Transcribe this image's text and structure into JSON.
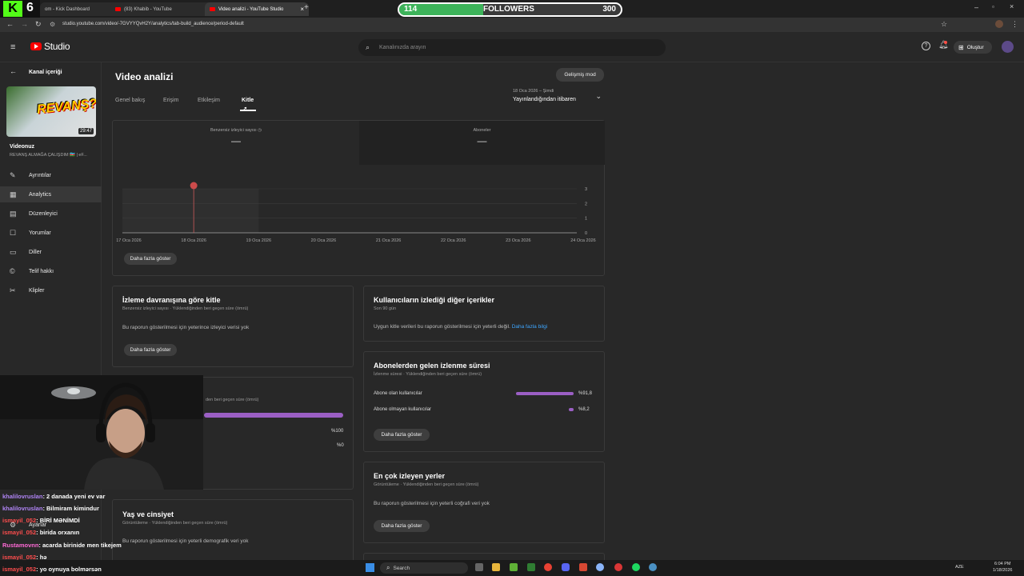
{
  "browser": {
    "tabs": [
      {
        "title": "om - Kick Dashboard",
        "active": false
      },
      {
        "title": "(83) Khabib - YouTube",
        "active": false
      },
      {
        "title": "Video analizi - YouTube Studio",
        "active": true
      }
    ],
    "url": "studio.youtube.com/video/-7GVYYQvH2Y/analytics/tab-build_audience/period-default"
  },
  "overlay": {
    "kick_count": "6",
    "followers_current": "114",
    "followers_label": "FOLLOWERS",
    "followers_goal": "300",
    "followers_progress": 0.38,
    "bar_color": "#3db35a"
  },
  "header": {
    "brand": "Studio",
    "search_placeholder": "Kanalınızda arayın",
    "create_label": "Oluştur"
  },
  "sidebar": {
    "back_label": "Kanal içeriği",
    "thumb_text": "REVANŞ?",
    "thumb_duration": "29:47",
    "video_label": "Videonuz",
    "video_title": "REVANŞ ALMAĞA ÇALIŞDIM 🇦🇿 | eF...",
    "items": [
      {
        "label": "Ayrıntılar",
        "icon": "pencil-icon"
      },
      {
        "label": "Analytics",
        "icon": "analytics-icon"
      },
      {
        "label": "Düzenleyici",
        "icon": "editor-icon"
      },
      {
        "label": "Yorumlar",
        "icon": "comment-icon"
      },
      {
        "label": "Diller",
        "icon": "subtitles-icon"
      },
      {
        "label": "Telif hakkı",
        "icon": "copyright-icon"
      },
      {
        "label": "Klipler",
        "icon": "scissors-icon"
      }
    ],
    "settings_label": "Ayarlar"
  },
  "main": {
    "title": "Video analizi",
    "advanced_button": "Gelişmiş mod",
    "tabs": [
      "Genel bakış",
      "Erişim",
      "Etkileşim",
      "Kitle"
    ],
    "active_tab": "Kitle",
    "period_range": "18 Oca 2026 – Şimdi",
    "period_label": "Yayınlandığından itibaren",
    "metric1_label": "Benzersiz izleyici sayısı",
    "metric1_value": "—",
    "metric2_label": "Aboneler",
    "metric2_value": "—",
    "more_button": "Daha fazla göster",
    "card_behavior": {
      "title": "İzleme davranışına göre kitle",
      "subtitle": "Benzersiz izleyici sayısı · Yüklendiğinden beri geçen süre (ömrü)",
      "message": "Bu raporun gösterilmesi için yeterince izleyici verisi yok",
      "button": "Daha fazla göster"
    },
    "card_other": {
      "title": "Kullanıcıların izlediği diğer içerikler",
      "subtitle": "Son 90 gün",
      "message": "Uygun kitle verileri bu raporun gösterilmesi için yeterli değil.",
      "link": "Daha fazla bilgi"
    },
    "card_subs": {
      "title": "Abonelerden gelen izlenme süresi",
      "subtitle": "İzlenme süresi · Yüklendiğinden beri geçen süre (ömrü)",
      "rows": [
        {
          "label": "Abone olan kullanıcılar",
          "value": "%91,8",
          "fraction": 0.918
        },
        {
          "label": "Abone olmayan kullanıcılar",
          "value": "%8,2",
          "fraction": 0.082
        }
      ],
      "button": "Daha fazla göster"
    },
    "card_partial": {
      "subtitle": "den beri geçen süre (ömrü)",
      "values": [
        "%100",
        "%0"
      ]
    },
    "card_locations": {
      "title": "En çok izleyen yerler",
      "subtitle": "Görüntüleme · Yüklendiğinden beri geçen süre (ömrü)",
      "message": "Bu raporun gösterilmesi için yeterli coğrafi veri yok",
      "button": "Daha fazla göster"
    },
    "card_age": {
      "title": "Yaş ve cinsiyet",
      "subtitle": "Görüntüleme · Yüklendiğinden beri geçen süre (ömrü)",
      "message": "Bu raporun gösterilmesi için yeterli demografik veri yok"
    },
    "accent_color": "#9b5fc4"
  },
  "chart_data": {
    "type": "line",
    "x": [
      "17 Oca 2026",
      "18 Oca 2026",
      "19 Oca 2026",
      "20 Oca 2026",
      "21 Oca 2026",
      "22 Oca 2026",
      "23 Oca 2026",
      "24 Oca 2026"
    ],
    "y_ticks": [
      "0",
      "1",
      "2",
      "3"
    ],
    "ylim": [
      0,
      3
    ],
    "publish_marker_x": "18 Oca 2026",
    "series": [],
    "grid": true
  },
  "chat": [
    {
      "user": "khalilovruslan",
      "msg": ": 2 danada yeni ev var",
      "color": "#b084f5"
    },
    {
      "user": "khalilovruslan",
      "msg": ": Bilmiram kimindur",
      "color": "#b084f5"
    },
    {
      "user": "ismayil_052",
      "msg": ": BİRİ MƏNİMDİ",
      "color": "#ff4d4d"
    },
    {
      "user": "ismayil_052",
      "msg": ": birida orxanın",
      "color": "#ff4d4d"
    },
    {
      "user": "Rustamovnn",
      "msg": ": acarda birinide men tikejem",
      "color": "#ff6ad5"
    },
    {
      "user": "ismayil_052",
      "msg": ": hə",
      "color": "#ff4d4d"
    },
    {
      "user": "ismayil_052",
      "msg": ": yo oynuya bolmərsən",
      "color": "#ff4d4d"
    }
  ],
  "taskbar": {
    "search_label": "Search",
    "lang": "AZE",
    "time": "6:04 PM",
    "date": "1/18/2026"
  }
}
